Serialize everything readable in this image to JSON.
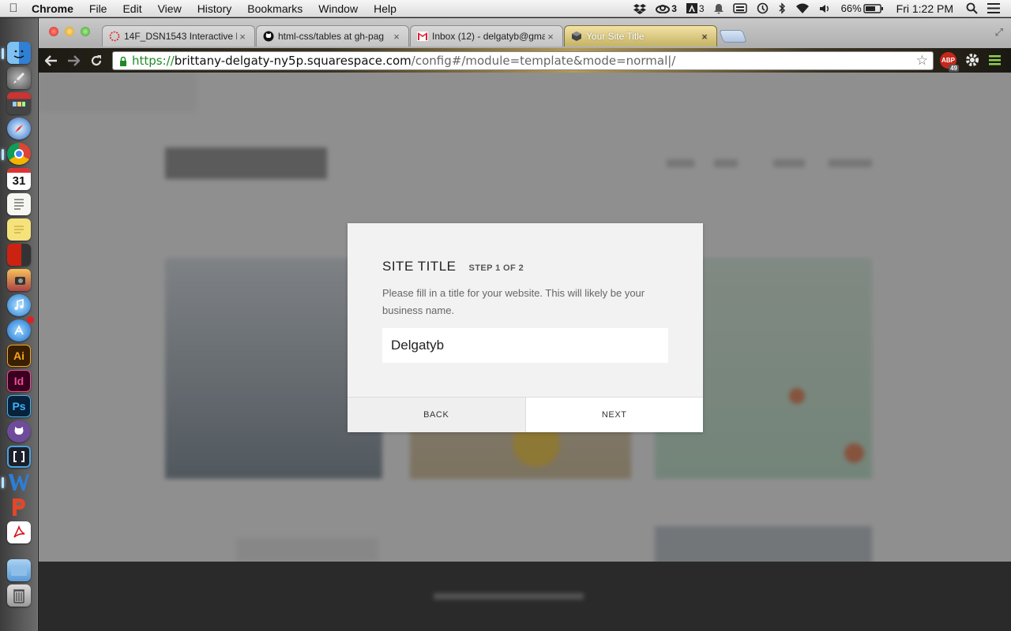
{
  "menubar": {
    "app_name": "Chrome",
    "menus": [
      "File",
      "Edit",
      "View",
      "History",
      "Bookmarks",
      "Window",
      "Help"
    ],
    "status": {
      "cc_count": "3",
      "adobe_count": "3",
      "battery": "66%",
      "clock": "Fri 1:22 PM"
    }
  },
  "dock": {
    "apps": [
      "finder-icon",
      "launchpad-icon",
      "photo-booth-icon",
      "safari-icon",
      "chrome-icon",
      "calendar-icon",
      "textedit-icon",
      "stickies-icon",
      "photo-slideshow-icon",
      "iphoto-icon",
      "itunes-icon",
      "app-store-icon",
      "illustrator-icon",
      "indesign-icon",
      "photoshop-icon",
      "github-icon",
      "brackets-icon",
      "word-icon",
      "powerpoint-icon",
      "acrobat-icon",
      "folder-icon",
      "trash-icon"
    ],
    "calendar_day": "31",
    "illustrator_label": "Ai",
    "indesign_label": "Id",
    "photoshop_label": "Ps"
  },
  "browser": {
    "tabs": [
      {
        "title": "14F_DSN1543 Interactive D"
      },
      {
        "title": "html-css/tables at gh-pag"
      },
      {
        "title": "Inbox (12) - delgatyb@gma"
      },
      {
        "title": "Your Site Title"
      }
    ],
    "url": {
      "scheme": "https://",
      "host": "brittany-delgaty-ny5p.squarespace.com",
      "path": "/config#/module=template&mode=normal|/"
    },
    "abp_count": "49"
  },
  "modal": {
    "title": "SITE TITLE",
    "step": "STEP 1 OF 2",
    "description": "Please fill in a title for your website. This will likely be your business name.",
    "field_value": "Delgatyb",
    "back_label": "BACK",
    "next_label": "NEXT"
  }
}
